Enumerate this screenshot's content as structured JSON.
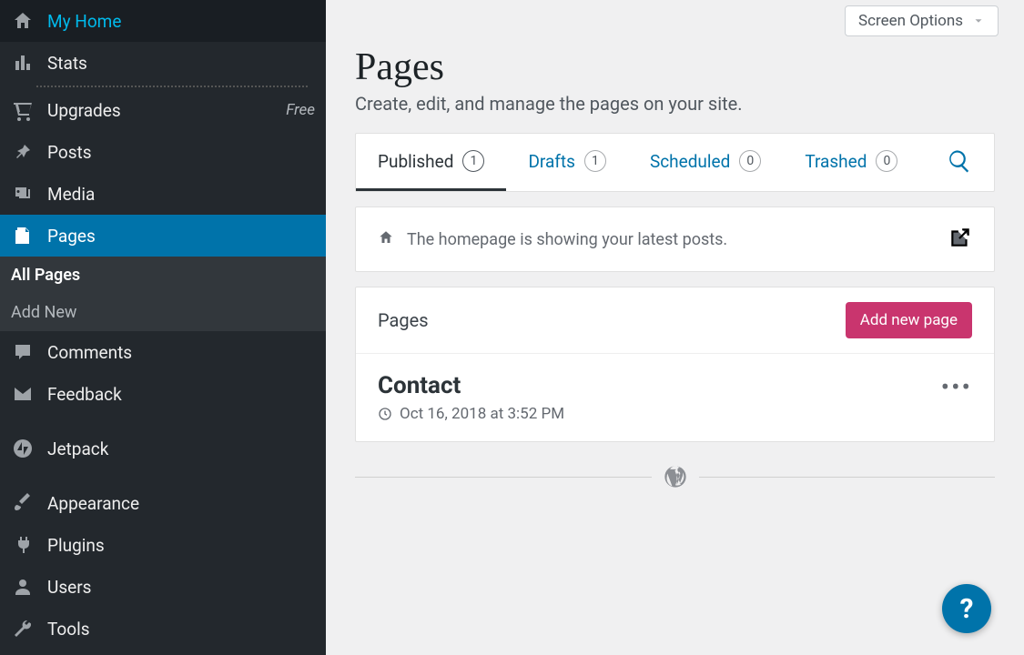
{
  "sidebar": {
    "items": [
      {
        "label": "My Home"
      },
      {
        "label": "Stats"
      },
      {
        "label": "Upgrades",
        "meta": "Free"
      },
      {
        "label": "Posts"
      },
      {
        "label": "Media"
      },
      {
        "label": "Pages"
      },
      {
        "label": "Comments"
      },
      {
        "label": "Feedback"
      },
      {
        "label": "Jetpack"
      },
      {
        "label": "Appearance"
      },
      {
        "label": "Plugins"
      },
      {
        "label": "Users"
      },
      {
        "label": "Tools"
      }
    ],
    "sub": [
      {
        "label": "All Pages"
      },
      {
        "label": "Add New"
      }
    ]
  },
  "screen_options": "Screen Options",
  "header": {
    "title": "Pages",
    "desc": "Create, edit, and manage the pages on your site."
  },
  "tabs": [
    {
      "label": "Published",
      "count": "1"
    },
    {
      "label": "Drafts",
      "count": "1"
    },
    {
      "label": "Scheduled",
      "count": "0"
    },
    {
      "label": "Trashed",
      "count": "0"
    }
  ],
  "home_notice": "The homepage is showing your latest posts.",
  "pages_section": {
    "label": "Pages",
    "add_label": "Add new page"
  },
  "page_rows": [
    {
      "title": "Contact",
      "date": "Oct 16, 2018 at 3:52 PM"
    }
  ],
  "help": "?"
}
